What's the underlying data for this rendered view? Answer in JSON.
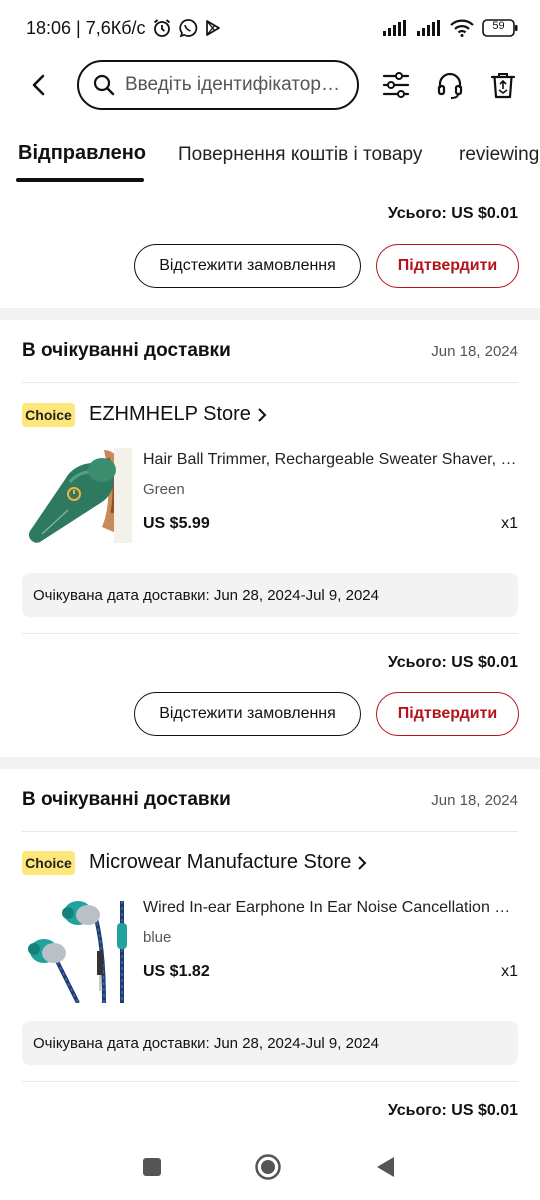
{
  "status_bar": {
    "time_speed": "18:06 | 7,6Кб/с",
    "battery": "59",
    "icons": [
      "alarm-icon",
      "viber-icon",
      "play-store-icon",
      "signal-icon",
      "signal-icon",
      "wifi-icon",
      "battery-icon"
    ]
  },
  "top_bar": {
    "search_placeholder": "Введіть ідентифікатор замовлення",
    "icons": [
      "back-icon",
      "search-icon",
      "filter-icon",
      "headset-icon",
      "trash-icon"
    ]
  },
  "tabs": [
    {
      "label": "Відправлено",
      "active": true
    },
    {
      "label": "Повернення коштів і товару",
      "active": false
    },
    {
      "label": "reviewing",
      "active": false
    }
  ],
  "top_order_footer": {
    "total": "Усього: US $0.01",
    "track_label": "Відстежити замовлення",
    "confirm_label": "Підтвердити"
  },
  "orders": [
    {
      "status": "В очікуванні доставки",
      "date": "Jun 18, 2024",
      "badge": "Choice",
      "store": "EZHMHELP Store",
      "product": {
        "title": "Hair Ball Trimmer, Rechargeable Sweater Shaver, Lint Remover",
        "variant": "Green",
        "price": "US $5.99",
        "qty": "x1"
      },
      "delivery": "Очікувана дата доставки: Jun 28, 2024-Jul 9, 2024",
      "total": "Усього: US $0.01",
      "track_label": "Відстежити замовлення",
      "confirm_label": "Підтвердити"
    },
    {
      "status": "В очікуванні доставки",
      "date": "Jun 18, 2024",
      "badge": "Choice",
      "store": "Microwear Manufacture Store",
      "product": {
        "title": "Wired In-ear Earphone In Ear Noise Cancellation Headphones",
        "variant": "blue",
        "price": "US $1.82",
        "qty": "x1"
      },
      "delivery": "Очікувана дата доставки: Jun 28, 2024-Jul 9, 2024",
      "total": "Усього: US $0.01"
    }
  ],
  "colors": {
    "accent_red": "#b3151d",
    "choice_yellow": "#fde77b",
    "section_gap": "#f2f2f2",
    "delivery_bg": "#f3f3f3"
  }
}
